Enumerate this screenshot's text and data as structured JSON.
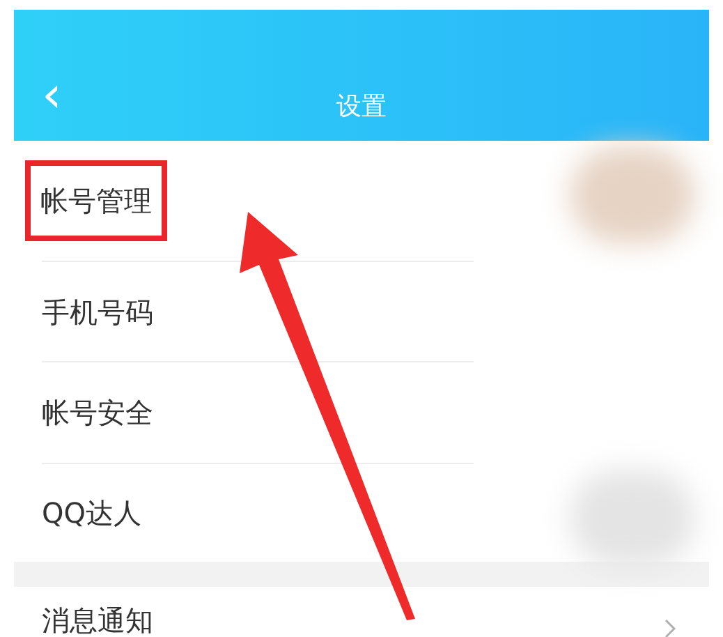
{
  "header": {
    "back": "‹",
    "title": "设置"
  },
  "groups": [
    {
      "items": [
        {
          "label": "帐号管理",
          "highlighted": true,
          "chevron": false,
          "avatar": true
        },
        {
          "label": "手机号码",
          "highlighted": false,
          "chevron": false,
          "avatar": false
        },
        {
          "label": "帐号安全",
          "highlighted": false,
          "chevron": false,
          "avatar": false
        },
        {
          "label": "QQ达人",
          "highlighted": false,
          "chevron": false,
          "avatar": true
        }
      ]
    },
    {
      "items": [
        {
          "label": "消息通知",
          "highlighted": false,
          "chevron": true,
          "avatar": false
        }
      ]
    }
  ]
}
